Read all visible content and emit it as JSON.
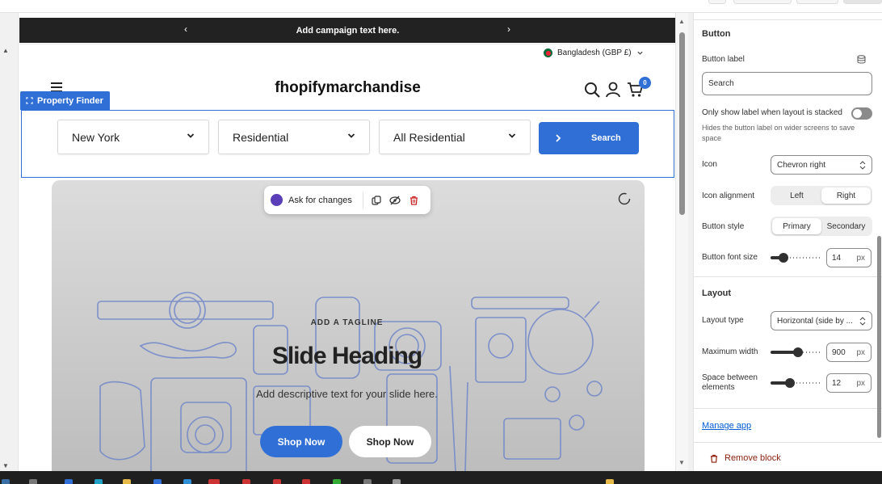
{
  "announcement": {
    "text": "Add campaign text here.",
    "prev": "‹",
    "next": "›"
  },
  "locale": {
    "label": "Bangladesh (GBP £)"
  },
  "store": {
    "brand": "fhopifymarchandise",
    "cart_count": "0"
  },
  "property_finder": {
    "tag": "Property Finder",
    "selects": [
      {
        "value": "New York"
      },
      {
        "value": "Residential"
      },
      {
        "value": "All Residential"
      }
    ],
    "search_label": "Search"
  },
  "ai_toolbar": {
    "ask_label": "Ask for changes"
  },
  "slide": {
    "tagline": "ADD A TAGLINE",
    "heading": "Slide Heading",
    "description": "Add descriptive text for your slide here.",
    "primary_button": "Shop Now",
    "secondary_button": "Shop Now"
  },
  "settings": {
    "button_section": "Button",
    "button_label_label": "Button label",
    "button_label_value": "Search",
    "stacked_label": "Only show label when layout is stacked",
    "stacked_help": "Hides the button label on wider screens to save space",
    "icon_label": "Icon",
    "icon_value": "Chevron right",
    "icon_alignment_label": "Icon alignment",
    "icon_alignment_options": [
      "Left",
      "Right"
    ],
    "icon_alignment_selected": "Right",
    "button_style_label": "Button style",
    "button_style_options": [
      "Primary",
      "Secondary"
    ],
    "button_style_selected": "Primary",
    "font_size_label": "Button font size",
    "font_size_value": "14",
    "font_size_fraction": 0.2,
    "unit": "px",
    "layout_section": "Layout",
    "layout_type_label": "Layout type",
    "layout_type_value": "Horizontal (side by ...",
    "max_width_label": "Maximum width",
    "max_width_value": "900",
    "max_width_fraction": 0.55,
    "space_label": "Space between elements",
    "space_value": "12",
    "space_fraction": 0.35,
    "manage_app": "Manage app",
    "remove_block": "Remove block"
  },
  "colors": {
    "accent": "#2f6fd6",
    "announcement_bg": "#222222",
    "danger": "#8e1f0b",
    "link": "#005bd3"
  }
}
